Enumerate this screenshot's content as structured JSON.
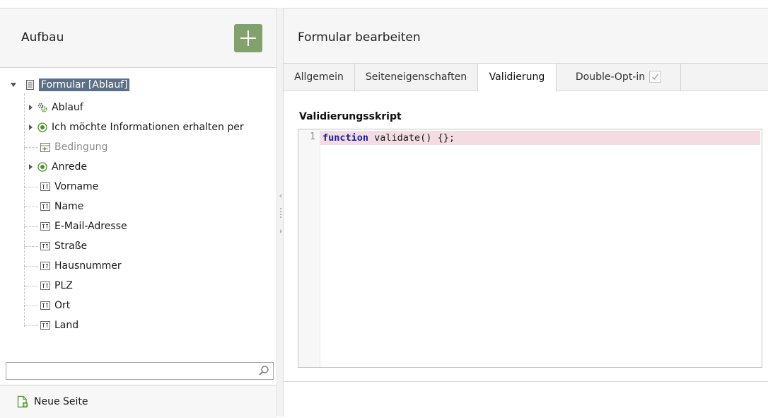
{
  "left": {
    "title": "Aufbau",
    "add_button_label": "+",
    "tree": [
      {
        "label": "Formular [Ablauf]",
        "icon": "form-icon",
        "expanded": true,
        "selected": true,
        "level": 0
      },
      {
        "label": "Ablauf",
        "icon": "gears-icon",
        "expandable": true,
        "level": 1
      },
      {
        "label": "Ich möchte Informationen erhalten per",
        "icon": "radio-icon",
        "expandable": true,
        "level": 1
      },
      {
        "label": "Bedingung",
        "icon": "condition-icon",
        "dimmed": true,
        "level": 1
      },
      {
        "label": "Anrede",
        "icon": "radio-icon",
        "expandable": true,
        "level": 1
      },
      {
        "label": "Vorname",
        "icon": "textfield-icon",
        "level": 1
      },
      {
        "label": "Name",
        "icon": "textfield-icon",
        "level": 1
      },
      {
        "label": "E-Mail-Adresse",
        "icon": "textfield-icon",
        "level": 1
      },
      {
        "label": "Straße",
        "icon": "textfield-icon",
        "level": 1
      },
      {
        "label": "Hausnummer",
        "icon": "textfield-icon",
        "level": 1
      },
      {
        "label": "PLZ",
        "icon": "textfield-icon",
        "level": 1
      },
      {
        "label": "Ort",
        "icon": "textfield-icon",
        "level": 1
      },
      {
        "label": "Land",
        "icon": "textfield-icon",
        "level": 1
      }
    ],
    "search": {
      "value": "",
      "placeholder": ""
    },
    "new_page_label": "Neue Seite"
  },
  "right": {
    "title": "Formular bearbeiten",
    "tabs": [
      {
        "label": "Allgemein"
      },
      {
        "label": "Seiteneigenschaften"
      },
      {
        "label": "Validierung",
        "active": true
      },
      {
        "label": "Double-Opt-in",
        "checked": true
      }
    ],
    "script_label": "Validierungsskript",
    "editor": {
      "lines": [
        {
          "number": "1",
          "keyword": "function",
          "rest": " validate() {};"
        }
      ]
    }
  },
  "colors": {
    "accent_green": "#81a36b",
    "selection_bg": "#5b6f86",
    "keyword": "#1c1ca8",
    "error_line_bg": "#f4dde2"
  }
}
